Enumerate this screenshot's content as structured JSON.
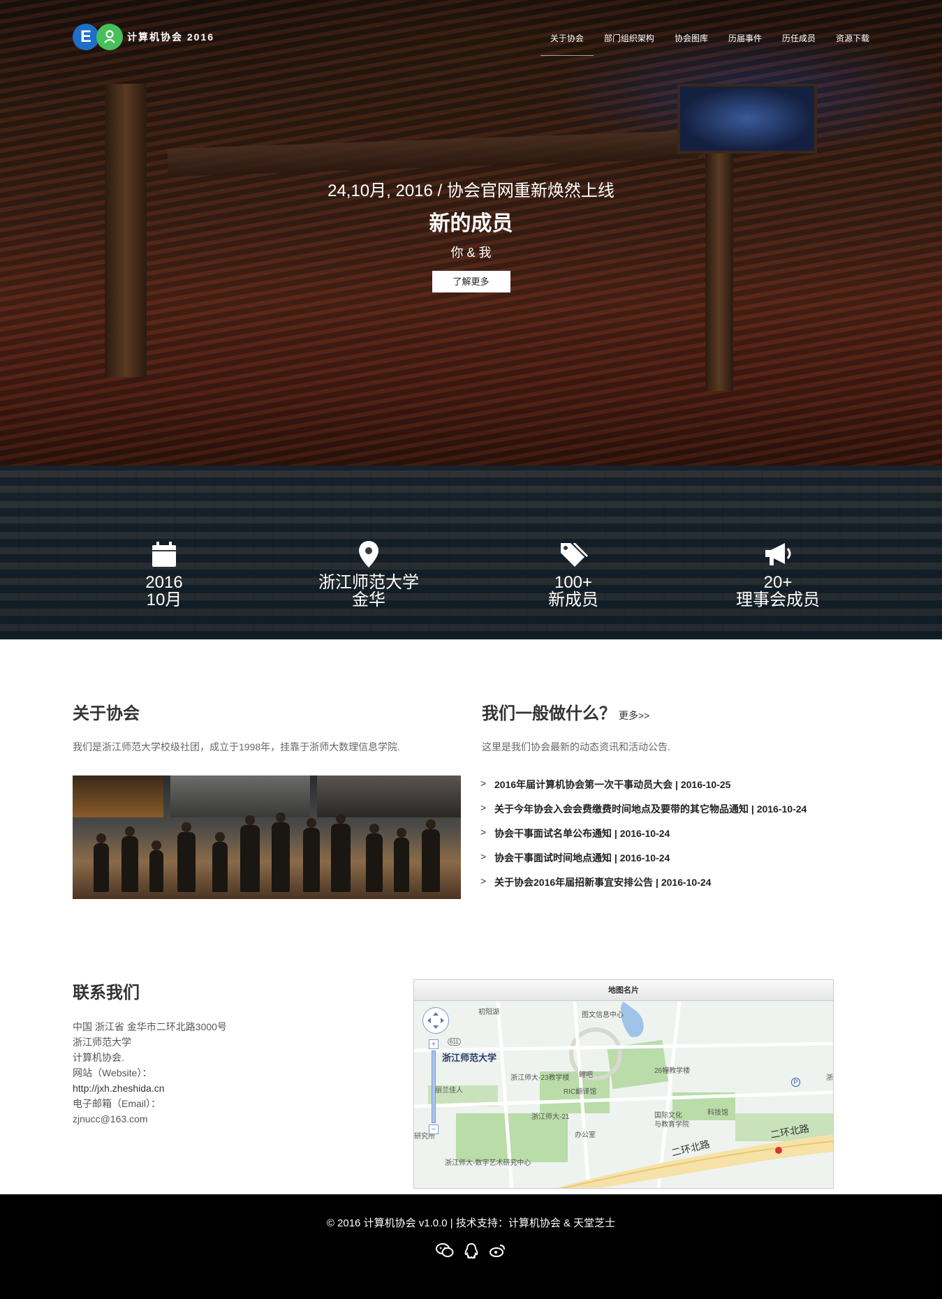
{
  "brand": {
    "logo_letter": "E",
    "name": "计算机协会 2016"
  },
  "nav": {
    "items": [
      {
        "label": "关于协会",
        "active": true
      },
      {
        "label": "部门组织架构"
      },
      {
        "label": "协会图库"
      },
      {
        "label": "历届事件"
      },
      {
        "label": "历任成员"
      },
      {
        "label": "资源下载"
      }
    ]
  },
  "hero": {
    "date": "24,10月, 2016 / 协会官网重新焕然上线",
    "title": "新的成员",
    "subtitle": "你 & 我",
    "button": "了解更多"
  },
  "stats": [
    {
      "icon": "calendar-icon",
      "line1": "2016",
      "line2": "10月"
    },
    {
      "icon": "map-pin-icon",
      "line1": "浙江师范大学",
      "line2": "金华"
    },
    {
      "icon": "tags-icon",
      "line1": "100+",
      "line2": "新成员"
    },
    {
      "icon": "megaphone-icon",
      "line1": "20+",
      "line2": "理事会成员"
    }
  ],
  "about": {
    "title": "关于协会",
    "description": "我们是浙江师范大学校级社团，成立于1998年，挂靠于浙师大数理信息学院."
  },
  "what": {
    "title": "我们一般做什么？",
    "more": "更多>>",
    "description": "这里是我们协会最新的动态资讯和活动公告.",
    "news": [
      "2016年届计算机协会第一次干事动员大会 | 2016-10-25",
      "关于今年协会入会会费缴费时间地点及要带的其它物品通知 | 2016-10-24",
      "协会干事面试名单公布通知 | 2016-10-24",
      "协会干事面试时间地点通知 | 2016-10-24",
      "关于协会2016年届招新事宜安排公告 | 2016-10-24"
    ]
  },
  "contact": {
    "title": "联系我们",
    "lines": [
      "中国 浙江省 金华市二环北路3000号",
      "浙江师范大学",
      "计算机协会.",
      "网站（Website）：",
      "http://jxh.zheshida.cn",
      "电子邮箱（Email）：",
      "zjnucc@163.com"
    ]
  },
  "map": {
    "header": "地图名片",
    "labels": {
      "university": "浙江师范大学",
      "l1": "初阳湖",
      "l2": "图文信息中心",
      "l3": "浙江师大-23教学楼",
      "l4": "鲤吧",
      "l5": "26幢教学楼",
      "l6": "RIC翻译馆",
      "l7": "丽兰佳人",
      "l8": "浙江师大-21",
      "l9": "国际文化",
      "l10": "与教育学院",
      "l11": "科技馆",
      "l12": "办公室",
      "l13": "研究所",
      "l14": "二环北路",
      "l15": "二环北路",
      "l16": "浙江师大-数字艺术研究中心",
      "road_badge": "611",
      "p_badge": "P",
      "cut": "浙"
    }
  },
  "footer": {
    "copyright": "© 2016 计算机协会 v1.0.0 | 技术支持：计算机协会 & 天堂芝士",
    "social": [
      "wechat-icon",
      "qq-icon",
      "weibo-icon"
    ]
  },
  "colors": {
    "logo_blue": "#1f6fc8",
    "logo_green": "#47c05a",
    "footer_bg": "#000000"
  }
}
